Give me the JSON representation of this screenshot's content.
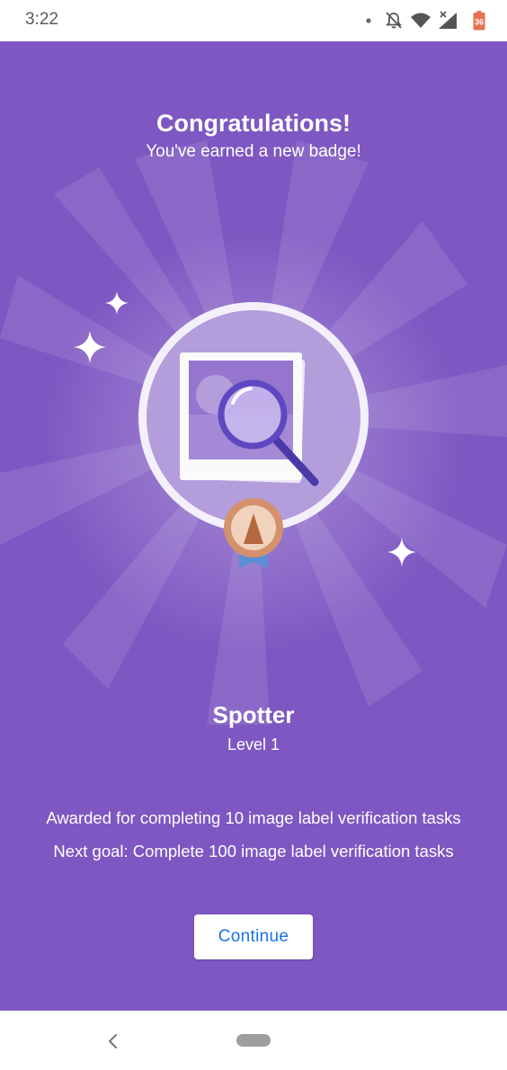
{
  "status_bar": {
    "time": "3:22",
    "icons": [
      "notification-dot-icon",
      "notifications-off-icon",
      "wifi-icon",
      "cell-signal-icon",
      "battery-icon"
    ],
    "battery_label": "36"
  },
  "dialog": {
    "title": "Congratulations!",
    "subtitle": "You've earned a new badge!",
    "badge": {
      "name": "Spotter",
      "level": "Level 1",
      "icon": "image-magnifier-icon",
      "medal": "bronze-medal-icon"
    },
    "awarded_text": "Awarded for completing 10 image label verification tasks",
    "next_goal_text": "Next goal: Complete 100 image label verification tasks",
    "continue_label": "Continue"
  },
  "colors": {
    "background": "#7e57c2",
    "accent": "#1a73e8",
    "medal": "#d4916c"
  },
  "nav_bar": {
    "icons": [
      "back-icon",
      "home-pill-icon"
    ]
  }
}
